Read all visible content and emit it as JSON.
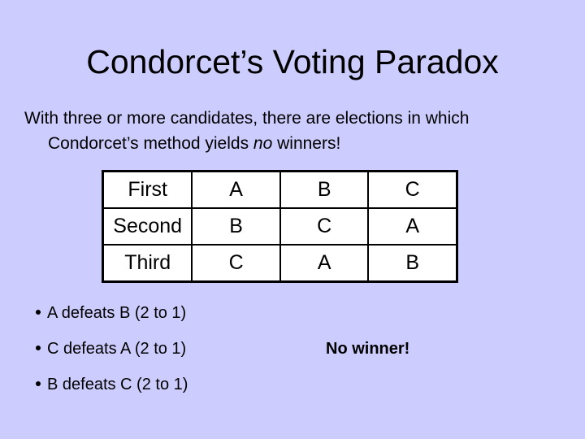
{
  "slide": {
    "title": "Condorcet’s Voting Paradox",
    "intro": {
      "line1": "With three or more candidates, there are elections in which",
      "line2_before": "Condorcet’s method yields ",
      "line2_emphasis": "no",
      "line2_after": " winners!"
    },
    "ballot_table": {
      "rows": [
        {
          "rank": "First",
          "ballots": [
            "A",
            "B",
            "C"
          ]
        },
        {
          "rank": "Second",
          "ballots": [
            "B",
            "C",
            "A"
          ]
        },
        {
          "rank": "Third",
          "ballots": [
            "C",
            "A",
            "B"
          ]
        }
      ]
    },
    "bullets": [
      "A defeats B (2 to 1)",
      "C defeats A (2 to 1)",
      "B defeats C (2 to 1)"
    ],
    "result": "No winner!",
    "colors": {
      "background": "#ccccfe",
      "table_background": "#ffffff",
      "text": "#000000"
    }
  }
}
